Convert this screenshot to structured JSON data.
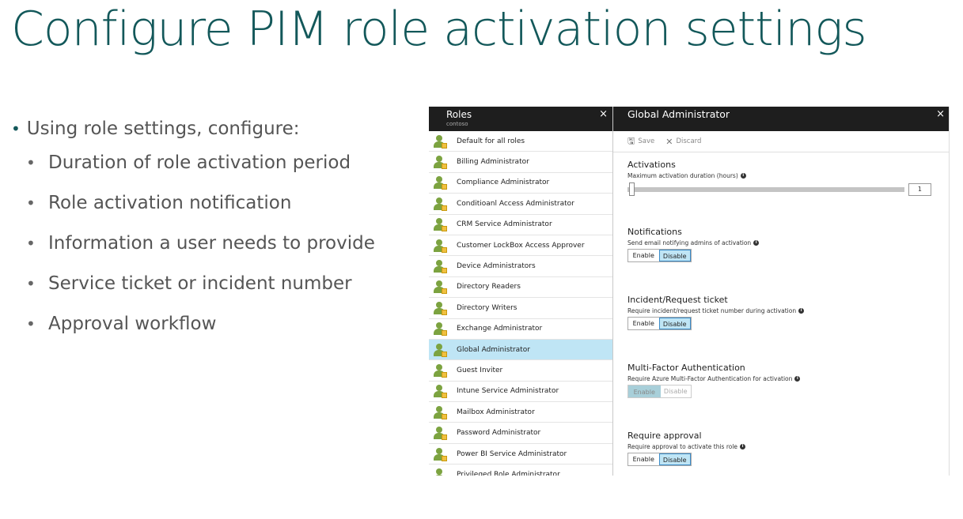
{
  "slide": {
    "title": "Configure PIM role activation settings",
    "main_bullet": "Using role settings, configure:",
    "sub_bullets": [
      "Duration of role activation period",
      "Role activation notification",
      "Information a user needs to provide",
      "Service ticket or incident number",
      "Approval workflow"
    ]
  },
  "roles_blade": {
    "title": "Roles",
    "subtitle": "contoso",
    "close": "×",
    "items": [
      "Default for all roles",
      "Billing Administrator",
      "Compliance Administrator",
      "Conditioanl Access Administrator",
      "CRM Service Administrator",
      "Customer LockBox Access Approver",
      "Device Administrators",
      "Directory Readers",
      "Directory Writers",
      "Exchange Administrator",
      "Global Administrator",
      "Guest Inviter",
      "Intune Service Administrator",
      "Mailbox Administrator",
      "Password Administrator",
      "Power BI Service Administrator",
      "Privileged Role Administrator"
    ],
    "selected_index": 10
  },
  "settings_blade": {
    "title": "Global Administrator",
    "close": "×",
    "toolbar": {
      "save": "Save",
      "discard": "Discard",
      "save_icon": "save-icon",
      "discard_icon": "discard-icon"
    },
    "activations": {
      "heading": "Activations",
      "desc": "Maximum activation duration (hours)",
      "value": "1"
    },
    "notifications": {
      "heading": "Notifications",
      "desc": "Send email notifying admins of activation",
      "enable": "Enable",
      "disable": "Disable",
      "selected": "Disable"
    },
    "incident": {
      "heading": "Incident/Request ticket",
      "desc": "Require incident/request ticket number during activation",
      "enable": "Enable",
      "disable": "Disable",
      "selected": "Disable"
    },
    "mfa": {
      "heading": "Multi-Factor Authentication",
      "desc": "Require Azure Multi-Factor Authentication for activation",
      "enable": "Enable",
      "disable": "Disable",
      "selected": "Enable",
      "disabled": true
    },
    "approval": {
      "heading": "Require approval",
      "desc": "Require approval to activate this role",
      "enable": "Enable",
      "disable": "Disable",
      "selected": "Disable"
    }
  }
}
